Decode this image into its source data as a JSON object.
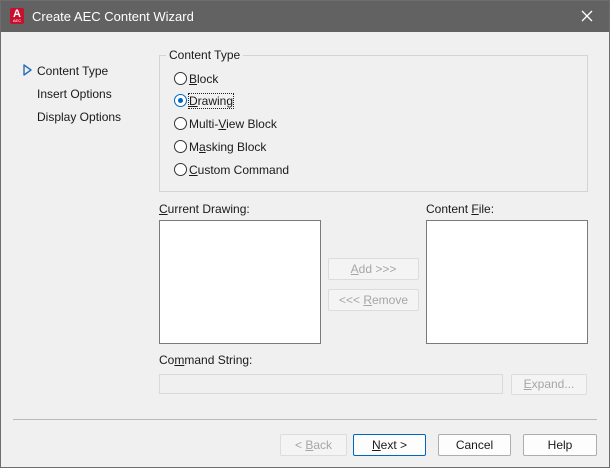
{
  "window": {
    "title": "Create AEC Content Wizard",
    "icon_letter": "A",
    "icon_sub": "AEC",
    "accent": "#0067c0",
    "titlebar_color": "#626262"
  },
  "nav": {
    "items": [
      {
        "label": "Content Type",
        "active": true
      },
      {
        "label": "Insert Options",
        "active": false
      },
      {
        "label": "Display Options",
        "active": false
      }
    ]
  },
  "content_type": {
    "group_label": "Content Type",
    "options": [
      {
        "pre": "",
        "key": "B",
        "post": "lock",
        "checked": false
      },
      {
        "pre": "",
        "key": "D",
        "post": "rawing",
        "checked": true
      },
      {
        "pre": "Multi-",
        "key": "V",
        "post": "iew Block",
        "checked": false
      },
      {
        "pre": "M",
        "key": "a",
        "post": "sking Block",
        "checked": false
      },
      {
        "pre": "",
        "key": "C",
        "post": "ustom Command",
        "checked": false
      }
    ]
  },
  "current_drawing": {
    "pre": "",
    "key": "C",
    "post": "urrent Drawing:"
  },
  "content_file": {
    "pre": "Content ",
    "key": "F",
    "post": "ile:"
  },
  "add_button": {
    "pre": "",
    "key": "A",
    "post": "dd >>>"
  },
  "remove_button": {
    "pre": "<<< ",
    "key": "R",
    "post": "emove"
  },
  "command_string": {
    "pre": "Co",
    "key": "m",
    "post": "mand String:",
    "value": ""
  },
  "expand_button": {
    "pre": "",
    "key": "E",
    "post": "xpand..."
  },
  "footer": {
    "back": {
      "pre": "< ",
      "key": "B",
      "post": "ack"
    },
    "next": {
      "pre": "",
      "key": "N",
      "post": "ext >"
    },
    "cancel": "Cancel",
    "help": "Help"
  }
}
